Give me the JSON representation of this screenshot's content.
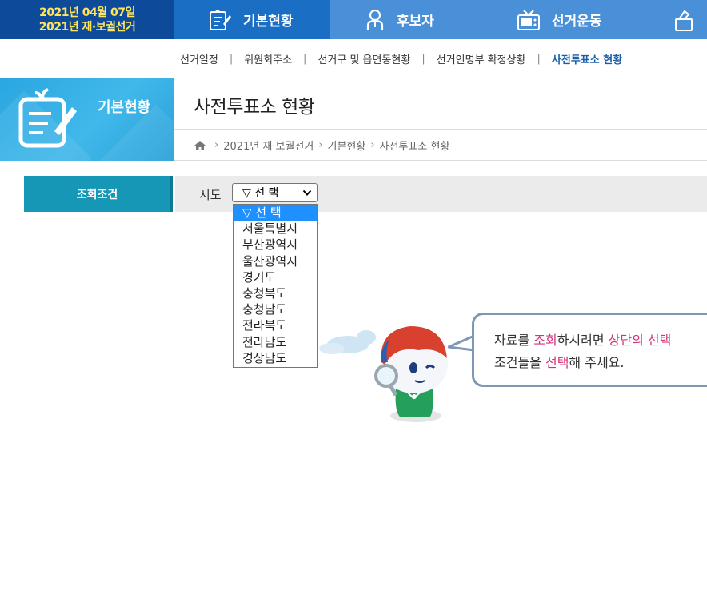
{
  "header": {
    "election_date": "2021년 04월 07일",
    "election_name": "2021년 재·보궐선거",
    "nav": [
      {
        "label": "기본현황"
      },
      {
        "label": "후보자"
      },
      {
        "label": "선거운동"
      }
    ]
  },
  "subnav": {
    "items": [
      {
        "label": "선거일정"
      },
      {
        "label": "위원회주소"
      },
      {
        "label": "선거구 및 읍면동현황"
      },
      {
        "label": "선거인명부 확정상황"
      },
      {
        "label": "사전투표소 현황"
      }
    ]
  },
  "category": {
    "label": "기본현황"
  },
  "page": {
    "title": "사전투표소 현황"
  },
  "breadcrumb": {
    "items": [
      "2021년 재·보궐선거",
      "기본현황",
      "사전투표소 현황"
    ]
  },
  "search": {
    "condition_label": "조회조건",
    "sido_label": "시도",
    "selected": "▽ 선 택",
    "options": [
      "▽ 선 택",
      "서울특별시",
      "부산광역시",
      "울산광역시",
      "경기도",
      "충청북도",
      "충청남도",
      "전라북도",
      "전라남도",
      "경상남도"
    ]
  },
  "notice": {
    "line1": {
      "a": "자료를 ",
      "b": "조회",
      "c": "하시려면 ",
      "d": "상단의 선택"
    },
    "line2": {
      "a": "조건들을 ",
      "b": "선택",
      "c": "해 주세요."
    }
  },
  "colors": {
    "top_bar": "#4a90d9",
    "badge": "#0d4b9a",
    "badge_text": "#ffe45c",
    "active_nav": "#1a6ec4",
    "condition_label": "#1597b5",
    "highlight": "#d4337a"
  }
}
